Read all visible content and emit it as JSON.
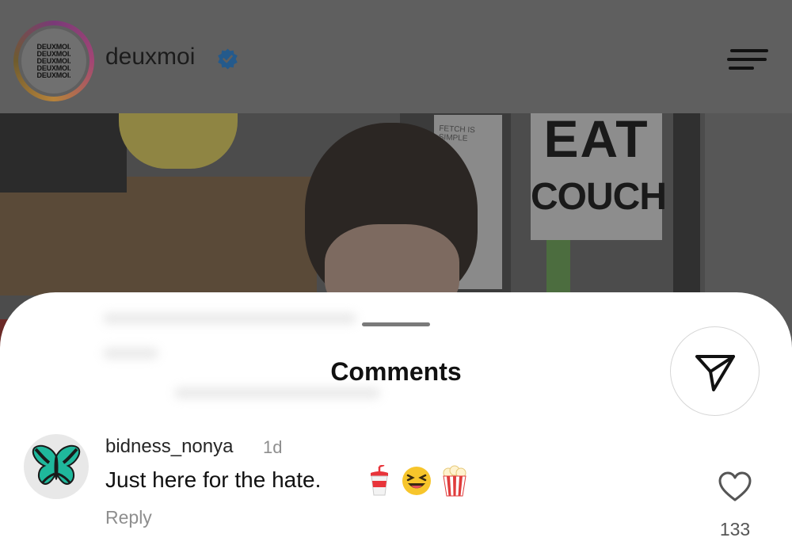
{
  "header": {
    "account_name": "deuxmoi",
    "logo_lines": [
      "DEUXMOI.",
      "DEUXMOI.",
      "DEUXMOI.",
      "DEUXMOI.",
      "DEUXMOI."
    ],
    "verified": true
  },
  "photo": {
    "poster_line1": "EAT",
    "poster_line2": "COUCH",
    "small_poster_text": "FETCH IS SIMPLE"
  },
  "sheet": {
    "title": "Comments"
  },
  "comment": {
    "username": "bidness_nonya",
    "time_ago": "1d",
    "text": "Just here for the hate.",
    "emojis": [
      "🥤",
      "😆",
      "🍿"
    ],
    "reply_label": "Reply",
    "like_count": "133"
  },
  "icons": {
    "share": "paper-plane-icon",
    "like": "heart-icon",
    "menu": "hamburger-menu-icon",
    "verified": "verified-badge-icon"
  },
  "colors": {
    "verified_blue": "#1f77f0",
    "butterfly_teal": "#1fb89c"
  }
}
